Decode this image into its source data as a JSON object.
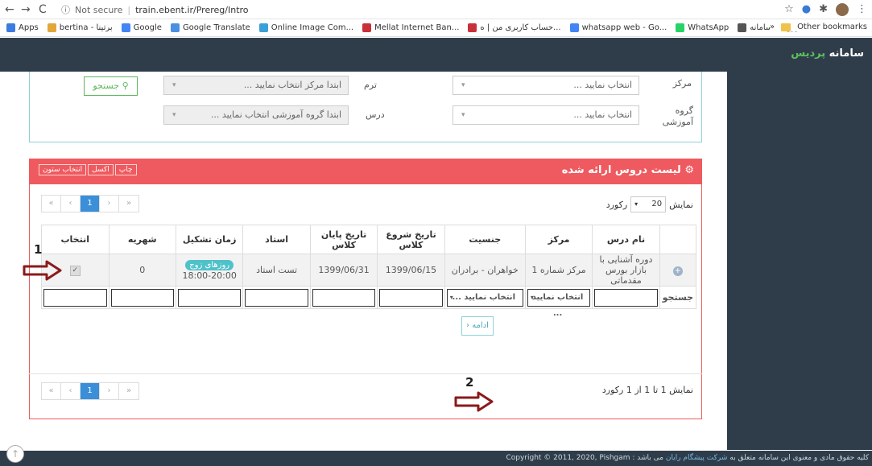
{
  "browser": {
    "url_status": "Not secure",
    "url": "train.ebent.ir/Prereg/Intro",
    "bookmarks": [
      {
        "label": "Apps",
        "color": "#3c7be0"
      },
      {
        "label": "bertina - برتینا",
        "color": "#e3a63a"
      },
      {
        "label": "Google",
        "color": "#4285f4"
      },
      {
        "label": "Google Translate",
        "color": "#4a90e2"
      },
      {
        "label": "Online Image Com...",
        "color": "#3aa0d8"
      },
      {
        "label": "Mellat Internet Ban...",
        "color": "#c8303a"
      },
      {
        "label": "حساب کاربری من | ه...",
        "color": "#c8303a"
      },
      {
        "label": "whatsapp web - Go...",
        "color": "#4285f4"
      },
      {
        "label": "WhatsApp",
        "color": "#25d366"
      },
      {
        "label": "ورود به سامانه",
        "color": "#555555"
      }
    ],
    "other_bookmarks": "Other bookmarks"
  },
  "header": {
    "brand_prefix": "سامانه ",
    "brand_accent": "پردیس"
  },
  "filters": {
    "center_label": "مرکز",
    "center_placeholder": "انتخاب نمایید ...",
    "term_label": "ترم",
    "term_placeholder": "ابتدا مرکز انتخاب نمایید ...",
    "group_label": "گروه آموزشی",
    "group_placeholder": "انتخاب نمایید ...",
    "course_label": "درس",
    "course_placeholder": "ابتدا گروه آموزشی انتخاب نمایید ...",
    "search_button": "جستجو"
  },
  "list": {
    "title": "لیست دروس ارائه شده",
    "print_button": "چاپ",
    "excel_button": "اکسل",
    "columns_button": "انتخاب ستون",
    "show_label": "نمایش",
    "page_size": "20",
    "records_label": "رکورد",
    "pager": [
      "«",
      "‹",
      "1",
      "›",
      "»"
    ],
    "columns": [
      "",
      "نام درس",
      "مرکز",
      "جنسیت",
      "تاریخ شروع کلاس",
      "تاریخ پایان کلاس",
      "استاد",
      "زمان تشکیل",
      "شهریه",
      "انتخاب"
    ],
    "rows": [
      {
        "name": "دوره آشنایی با بازار بورس مقدماتی",
        "center": "مرکز شماره 1",
        "gender": "خواهران - برادران",
        "start": "1399/06/15",
        "end": "1399/06/31",
        "teacher": "تست استاد",
        "schedule_badge": "روزهای زوج",
        "schedule_time": "18:00-20:00",
        "fee": "0",
        "checked": "✓"
      }
    ],
    "search_row_label": "جستجو",
    "search_select_1": "انتخاب نمایید ...",
    "search_select_2": "انتخاب نمایید ...",
    "records_info": "نمایش 1 تا 1 از 1 رکورد"
  },
  "continue_button": "ادامه ‹",
  "annotations": {
    "step1": "1",
    "step2": "2",
    "arrow_color": "#8b1a1a"
  },
  "footer": {
    "text_prefix": "کلیه حقوق مادی و معنوی این سامانه متعلق به ",
    "company": "شرکت پیشگام رایان",
    "text_suffix": " می باشد : ",
    "copyright": "Copyright © 2011, 2020, Pishgam"
  }
}
